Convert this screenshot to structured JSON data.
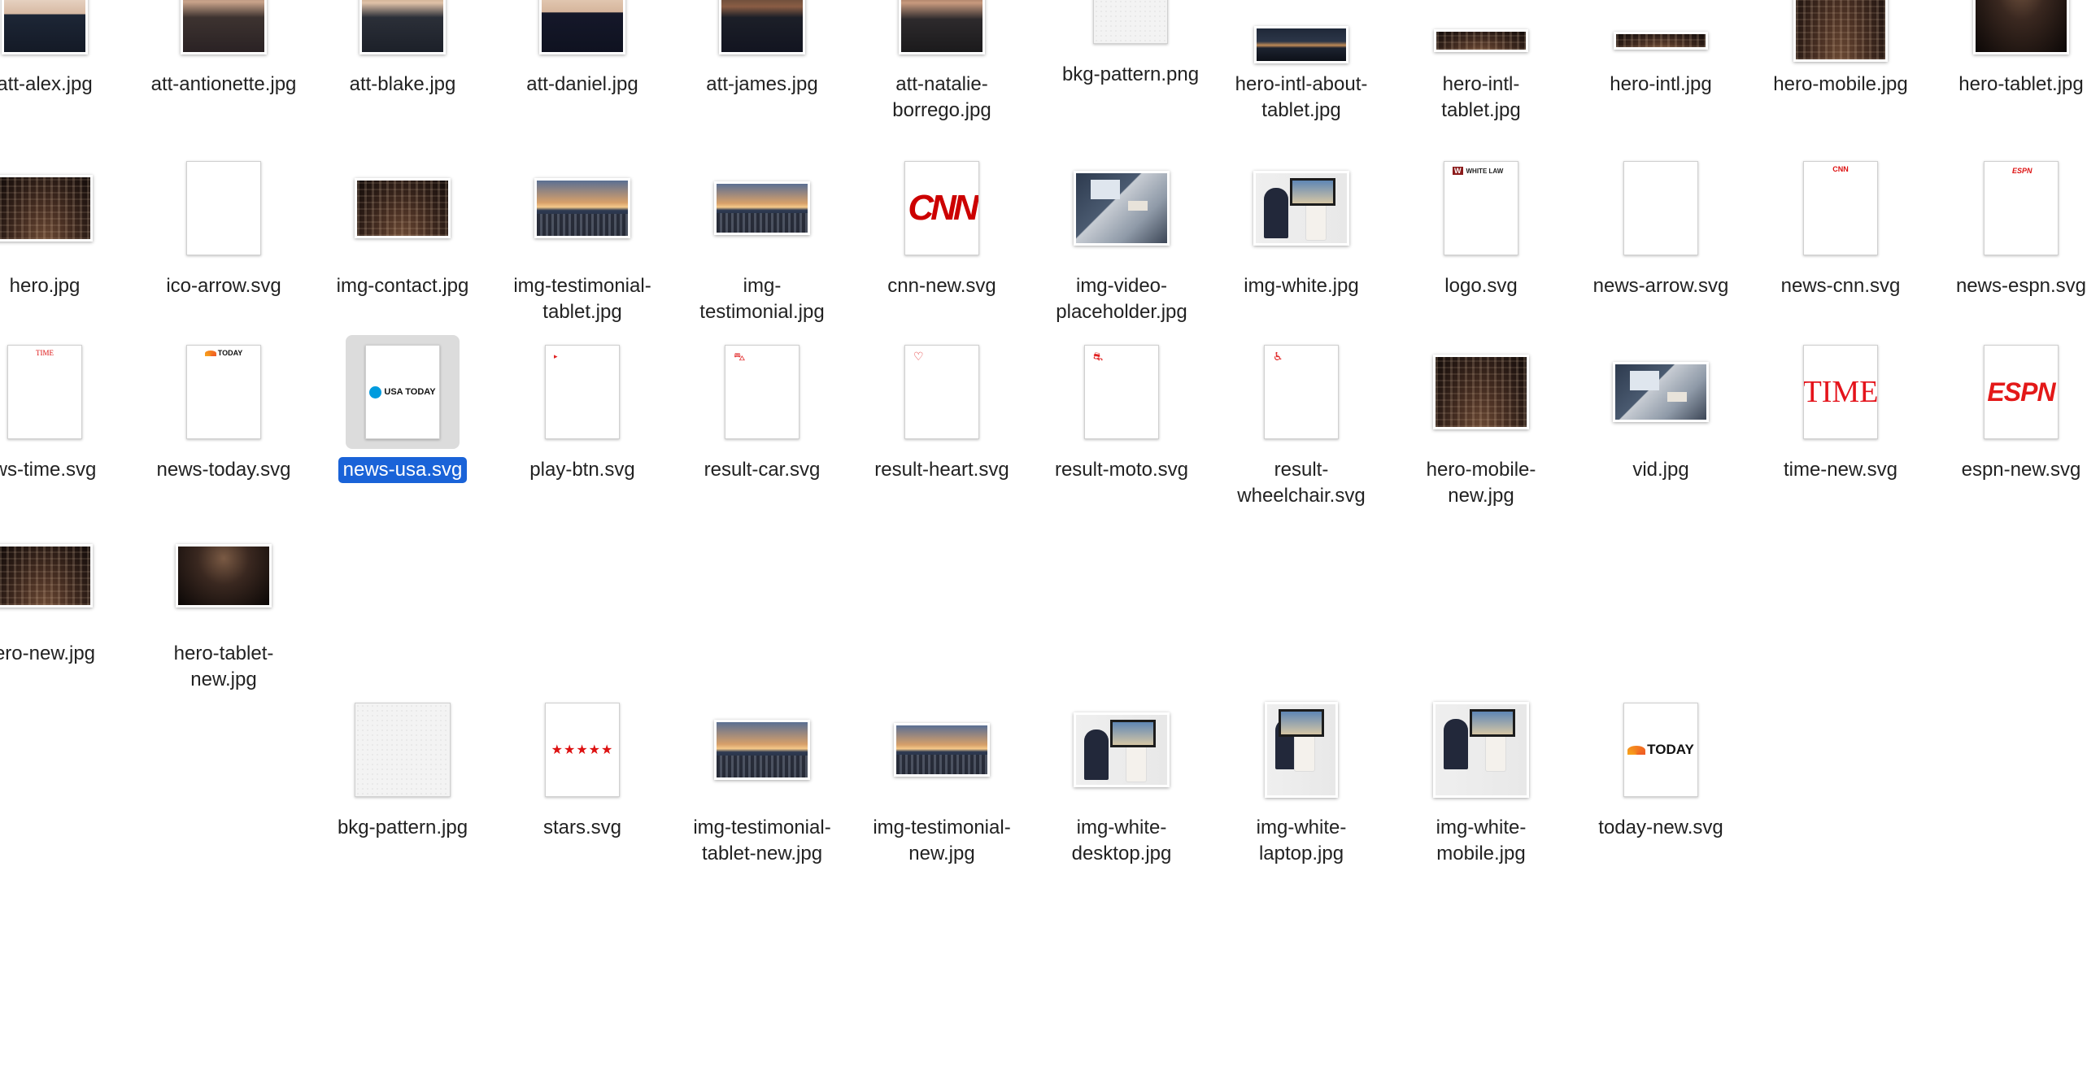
{
  "files": [
    {
      "name": "att-alex.jpg",
      "icon": "photo-icon"
    },
    {
      "name": "att-antionette.jpg",
      "icon": "photo-icon"
    },
    {
      "name": "att-blake.jpg",
      "icon": "photo-icon"
    },
    {
      "name": "att-daniel.jpg",
      "icon": "photo-icon"
    },
    {
      "name": "att-james.jpg",
      "icon": "photo-icon"
    },
    {
      "name": "att-natalie-\nborrego.jpg",
      "icon": "photo-icon"
    },
    {
      "name": "bkg-pattern.png",
      "icon": "image-icon"
    },
    {
      "name": "hero-intl-about-\ntablet.jpg",
      "icon": "photo-icon"
    },
    {
      "name": "hero-intl-\ntablet.jpg",
      "icon": "photo-icon"
    },
    {
      "name": "hero-intl.jpg",
      "icon": "photo-icon"
    },
    {
      "name": "hero-mobile.jpg",
      "icon": "photo-icon"
    },
    {
      "name": "hero-tablet.jpg",
      "icon": "photo-icon"
    },
    {
      "name": "hero.jpg",
      "icon": "photo-icon"
    },
    {
      "name": "ico-arrow.svg",
      "icon": "svg-document-icon"
    },
    {
      "name": "img-contact.jpg",
      "icon": "photo-icon"
    },
    {
      "name": "img-testimonial-\ntablet.jpg",
      "icon": "photo-icon"
    },
    {
      "name": "img-\ntestimonial.jpg",
      "icon": "photo-icon"
    },
    {
      "name": "cnn-new.svg",
      "icon": "cnn-logo-icon",
      "logo_text": "CNN"
    },
    {
      "name": "img-video-\nplaceholder.jpg",
      "icon": "photo-icon"
    },
    {
      "name": "img-white.jpg",
      "icon": "photo-icon"
    },
    {
      "name": "logo.svg",
      "icon": "white-law-logo-icon",
      "logo_text": "WHITE LAW"
    },
    {
      "name": "news-arrow.svg",
      "icon": "svg-document-icon"
    },
    {
      "name": "news-cnn.svg",
      "icon": "cnn-logo-icon",
      "logo_text": "CNN"
    },
    {
      "name": "news-espn.svg",
      "icon": "espn-logo-icon",
      "logo_text": "ESPN"
    },
    {
      "name": "ws-time.svg",
      "icon": "time-logo-icon",
      "logo_text": "TIME"
    },
    {
      "name": "news-today.svg",
      "icon": "today-logo-icon",
      "logo_text": "TODAY"
    },
    {
      "name": "news-usa.svg",
      "icon": "usa-today-logo-icon",
      "logo_text": "USA TODAY",
      "selected": true
    },
    {
      "name": "play-btn.svg",
      "icon": "play-icon"
    },
    {
      "name": "result-car.svg",
      "icon": "car-icon"
    },
    {
      "name": "result-heart.svg",
      "icon": "heart-icon"
    },
    {
      "name": "result-moto.svg",
      "icon": "motorcycle-icon"
    },
    {
      "name": "result-\nwheelchair.svg",
      "icon": "wheelchair-icon"
    },
    {
      "name": "hero-mobile-\nnew.jpg",
      "icon": "photo-icon"
    },
    {
      "name": "vid.jpg",
      "icon": "photo-icon"
    },
    {
      "name": "time-new.svg",
      "icon": "time-logo-icon",
      "logo_text": "TIME"
    },
    {
      "name": "espn-new.svg",
      "icon": "espn-logo-icon",
      "logo_text": "ESPN"
    },
    {
      "name": "ero-new.jpg",
      "icon": "photo-icon"
    },
    {
      "name": "hero-tablet-\nnew.jpg",
      "icon": "photo-icon"
    },
    {
      "name": "bkg-pattern.jpg",
      "icon": "image-icon"
    },
    {
      "name": "stars.svg",
      "icon": "stars-icon",
      "logo_text": "★★★★★"
    },
    {
      "name": "img-testimonial-\ntablet-new.jpg",
      "icon": "photo-icon"
    },
    {
      "name": "img-testimonial-\nnew.jpg",
      "icon": "photo-icon"
    },
    {
      "name": "img-white-\ndesktop.jpg",
      "icon": "photo-icon"
    },
    {
      "name": "img-white-\nlaptop.jpg",
      "icon": "photo-icon"
    },
    {
      "name": "img-white-\nmobile.jpg",
      "icon": "photo-icon"
    },
    {
      "name": "today-new.svg",
      "icon": "today-logo-icon",
      "logo_text": "TODAY"
    }
  ],
  "colors": {
    "selection_bg": "#1a63d8",
    "selection_text": "#ffffff",
    "thumb_selected_bg": "#dcdcdc",
    "label_text": "#222222"
  }
}
